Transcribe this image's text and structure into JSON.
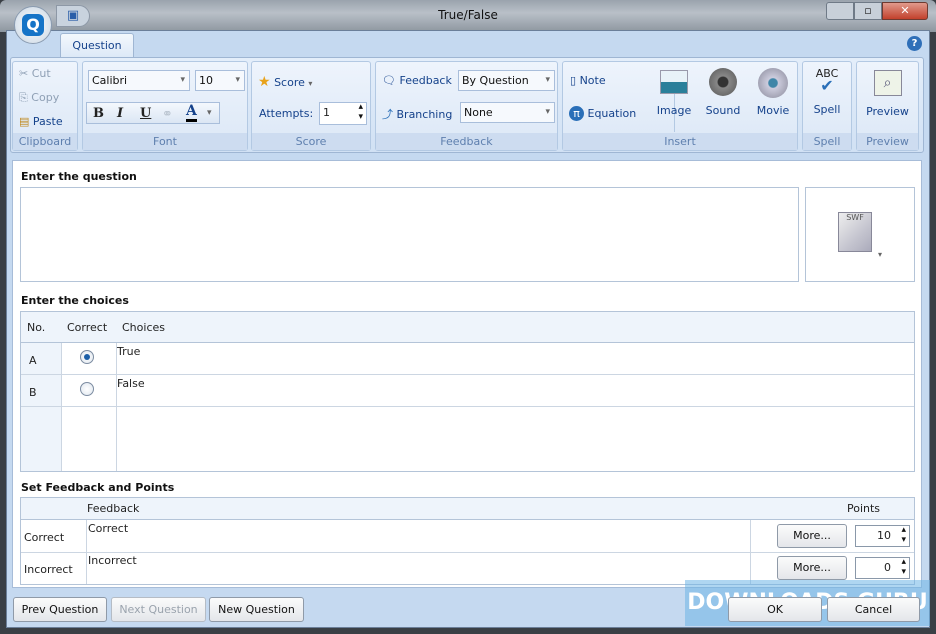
{
  "window": {
    "title": "True/False"
  },
  "ribbon": {
    "tab": "Question",
    "clipboard": {
      "cut": "Cut",
      "copy": "Copy",
      "paste": "Paste",
      "label": "Clipboard"
    },
    "font": {
      "family": "Calibri",
      "size": "10",
      "bold": "B",
      "italic": "I",
      "underline": "U",
      "color_glyph": "A",
      "label": "Font"
    },
    "score": {
      "score": "Score",
      "attempts_label": "Attempts:",
      "attempts": "1",
      "label": "Score"
    },
    "feedback": {
      "feedback": "Feedback",
      "feedback_value": "By Question",
      "branching": "Branching",
      "branching_value": "None",
      "label": "Feedback"
    },
    "insert": {
      "note": "Note",
      "equation": "Equation",
      "image": "Image",
      "sound": "Sound",
      "movie": "Movie",
      "label": "Insert"
    },
    "spell": {
      "button": "Spell",
      "abc": "ABC",
      "label": "Spell"
    },
    "preview": {
      "button": "Preview",
      "label": "Preview"
    }
  },
  "question": {
    "heading": "Enter the question",
    "value": ""
  },
  "choices": {
    "heading": "Enter the choices",
    "columns": [
      "No.",
      "Correct",
      "Choices"
    ],
    "rows": [
      {
        "no": "A",
        "correct": true,
        "text": "True"
      },
      {
        "no": "B",
        "correct": false,
        "text": "False"
      }
    ]
  },
  "feedback": {
    "heading": "Set Feedback and Points",
    "columns": [
      "",
      "Feedback",
      "Points"
    ],
    "rows": [
      {
        "label": "Correct",
        "text": "Correct",
        "more": "More...",
        "points": "10"
      },
      {
        "label": "Incorrect",
        "text": "Incorrect",
        "more": "More...",
        "points": "0"
      }
    ]
  },
  "footer": {
    "prev": "Prev Question",
    "next": "Next Question",
    "new": "New Question",
    "ok": "OK",
    "cancel": "Cancel"
  },
  "watermark": "DOWNLOADS GURU"
}
